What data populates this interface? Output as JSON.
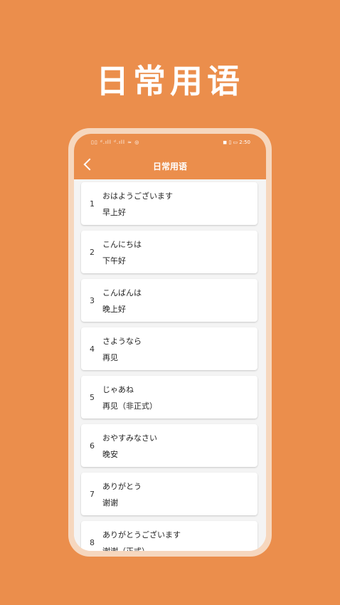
{
  "promo_title": "日常用语",
  "status": {
    "left": "▯▯ ᵈ.ıll ᵈ.ıll ≈ ◎",
    "right": "◼ ▯ ▭ 2:50"
  },
  "nav": {
    "title": "日常用语"
  },
  "items": [
    {
      "num": "1",
      "jp": "おはようございます",
      "cn": "早上好"
    },
    {
      "num": "2",
      "jp": "こんにちは",
      "cn": "下午好"
    },
    {
      "num": "3",
      "jp": "こんばんは",
      "cn": "晚上好"
    },
    {
      "num": "4",
      "jp": "さようなら",
      "cn": "再见"
    },
    {
      "num": "5",
      "jp": "じゃあね",
      "cn": "再见（非正式）"
    },
    {
      "num": "6",
      "jp": "おやすみなさい",
      "cn": "晚安"
    },
    {
      "num": "7",
      "jp": "ありがとう",
      "cn": "谢谢"
    },
    {
      "num": "8",
      "jp": "ありがとうございます",
      "cn": "谢谢（正式）"
    }
  ],
  "colors": {
    "background": "#EB8E4C",
    "frame": "#F6D7BE",
    "card": "#FFFFFF"
  }
}
